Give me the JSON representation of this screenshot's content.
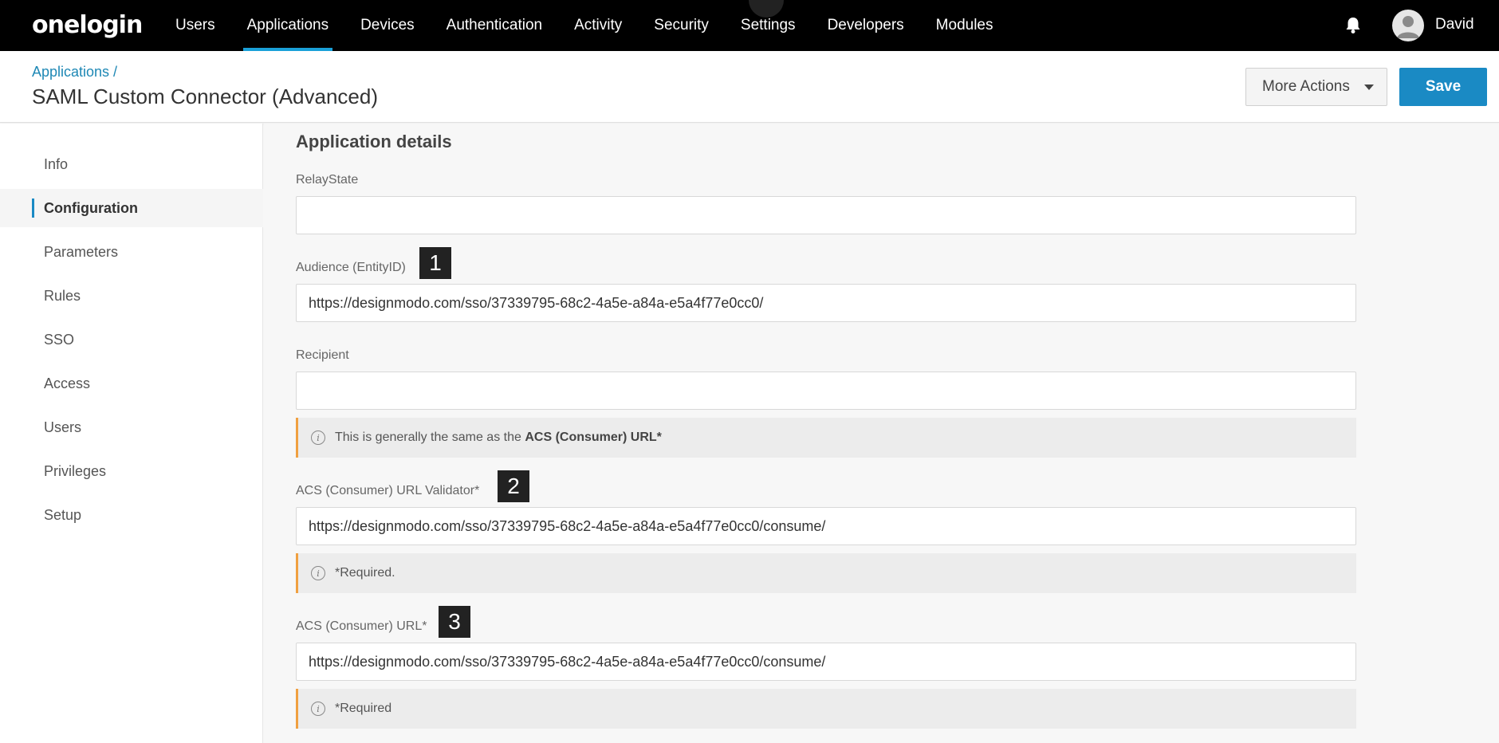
{
  "brand": {
    "logo_text": "onelogin"
  },
  "nav": {
    "items": [
      {
        "label": "Users"
      },
      {
        "label": "Applications",
        "active": true
      },
      {
        "label": "Devices"
      },
      {
        "label": "Authentication"
      },
      {
        "label": "Activity"
      },
      {
        "label": "Security"
      },
      {
        "label": "Settings"
      },
      {
        "label": "Developers"
      },
      {
        "label": "Modules"
      }
    ],
    "user_name": "David"
  },
  "header": {
    "breadcrumb": "Applications /",
    "title": "SAML Custom Connector (Advanced)",
    "more_actions_label": "More Actions",
    "save_label": "Save"
  },
  "sidebar": {
    "items": [
      {
        "label": "Info"
      },
      {
        "label": "Configuration",
        "active": true
      },
      {
        "label": "Parameters"
      },
      {
        "label": "Rules"
      },
      {
        "label": "SSO"
      },
      {
        "label": "Access"
      },
      {
        "label": "Users"
      },
      {
        "label": "Privileges"
      },
      {
        "label": "Setup"
      }
    ]
  },
  "main": {
    "section_title": "Application details",
    "relay_state": {
      "label": "RelayState",
      "value": ""
    },
    "audience": {
      "label": "Audience (EntityID)",
      "value": "https://designmodo.com/sso/37339795-68c2-4a5e-a84a-e5a4f77e0cc0/",
      "badge": "1"
    },
    "recipient": {
      "label": "Recipient",
      "value": ""
    },
    "recipient_note": {
      "prefix": "This is generally the same as the ",
      "bold": "ACS (Consumer) URL*"
    },
    "acs_validator": {
      "label": "ACS (Consumer) URL Validator*",
      "value": "https://designmodo.com/sso/37339795-68c2-4a5e-a84a-e5a4f77e0cc0/consume/",
      "badge": "2",
      "note": "*Required."
    },
    "acs_url": {
      "label": "ACS (Consumer) URL*",
      "value": "https://designmodo.com/sso/37339795-68c2-4a5e-a84a-e5a4f77e0cc0/consume/",
      "badge": "3",
      "note": "*Required"
    }
  },
  "colors": {
    "accent": "#1a8ac4",
    "note_border": "#f0a040",
    "nav_bg": "#000000"
  },
  "icons": {
    "notifications": "bell-icon",
    "info": "info-icon",
    "dropdown": "caret-down-icon"
  }
}
